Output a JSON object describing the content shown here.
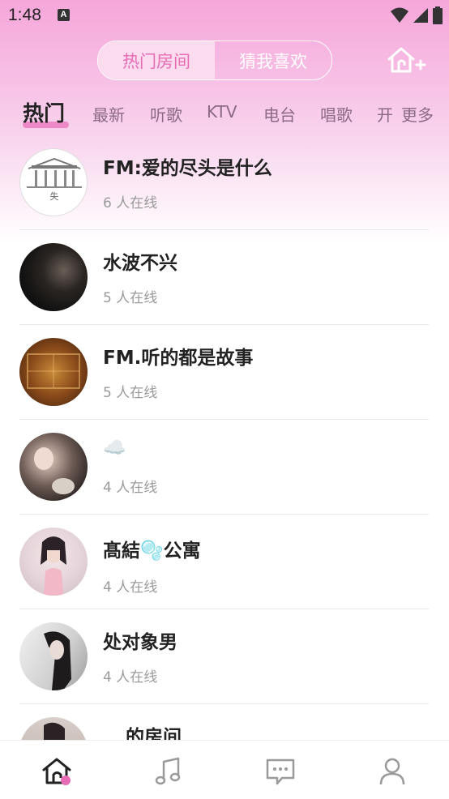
{
  "status": {
    "time": "1:48",
    "a_label": "A"
  },
  "header": {
    "segments": [
      {
        "label": "热门房间",
        "active": true
      },
      {
        "label": "猜我喜欢",
        "active": false
      }
    ],
    "add_room_icon": "home-plus-icon"
  },
  "tabs": [
    "热门",
    "最新",
    "听歌",
    "KTV",
    "电台",
    "唱歌",
    "开",
    "更多"
  ],
  "rooms": [
    {
      "title": "FM:爱的尽头是什么",
      "online": "6 人在线",
      "avatar": "museum-sketch"
    },
    {
      "title": "水波不兴",
      "online": "5 人在线",
      "avatar": "dark-portrait"
    },
    {
      "title": "FM.听的都是故事",
      "online": "5 人在线",
      "avatar": "grocery-store-sign"
    },
    {
      "title": "☁️",
      "online": "4 人在线",
      "avatar": "girl-with-cat"
    },
    {
      "title": "髙結🫧公寓",
      "online": "4 人在线",
      "avatar": "girl-pink-dress"
    },
    {
      "title": "处对象男",
      "online": "4 人在线",
      "avatar": "girl-black-hair"
    },
    {
      "title": "的房间",
      "online": "",
      "avatar": "girl-partial"
    }
  ],
  "bottom_nav": [
    {
      "name": "home",
      "icon": "home-icon",
      "active": true
    },
    {
      "name": "music",
      "icon": "music-note-icon",
      "active": false
    },
    {
      "name": "messages",
      "icon": "chat-icon",
      "active": false
    },
    {
      "name": "profile",
      "icon": "person-icon",
      "active": false
    }
  ],
  "colors": {
    "accent": "#e86bb6",
    "header_pink": "#f5a6da"
  }
}
